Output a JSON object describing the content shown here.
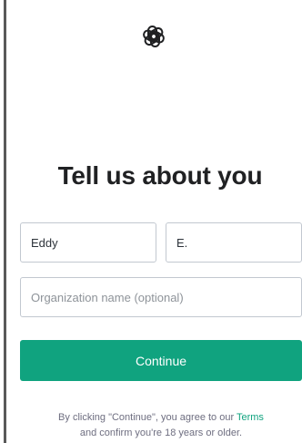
{
  "header": {
    "logo_icon": "openai-logo-icon"
  },
  "form": {
    "title": "Tell us about you",
    "first_name_value": "Eddy",
    "last_name_value": "E.",
    "organization_placeholder": "Organization name (optional)",
    "organization_value": "",
    "continue_label": "Continue"
  },
  "footer": {
    "disclaimer_prefix": "By clicking \"Continue\", you agree to our ",
    "terms_link": "Terms",
    "disclaimer_line2": "and confirm you're 18 years or older."
  },
  "colors": {
    "accent": "#10a37f",
    "title": "#202123",
    "muted_text": "#6e6e80",
    "input_border": "#c2c8d0"
  }
}
